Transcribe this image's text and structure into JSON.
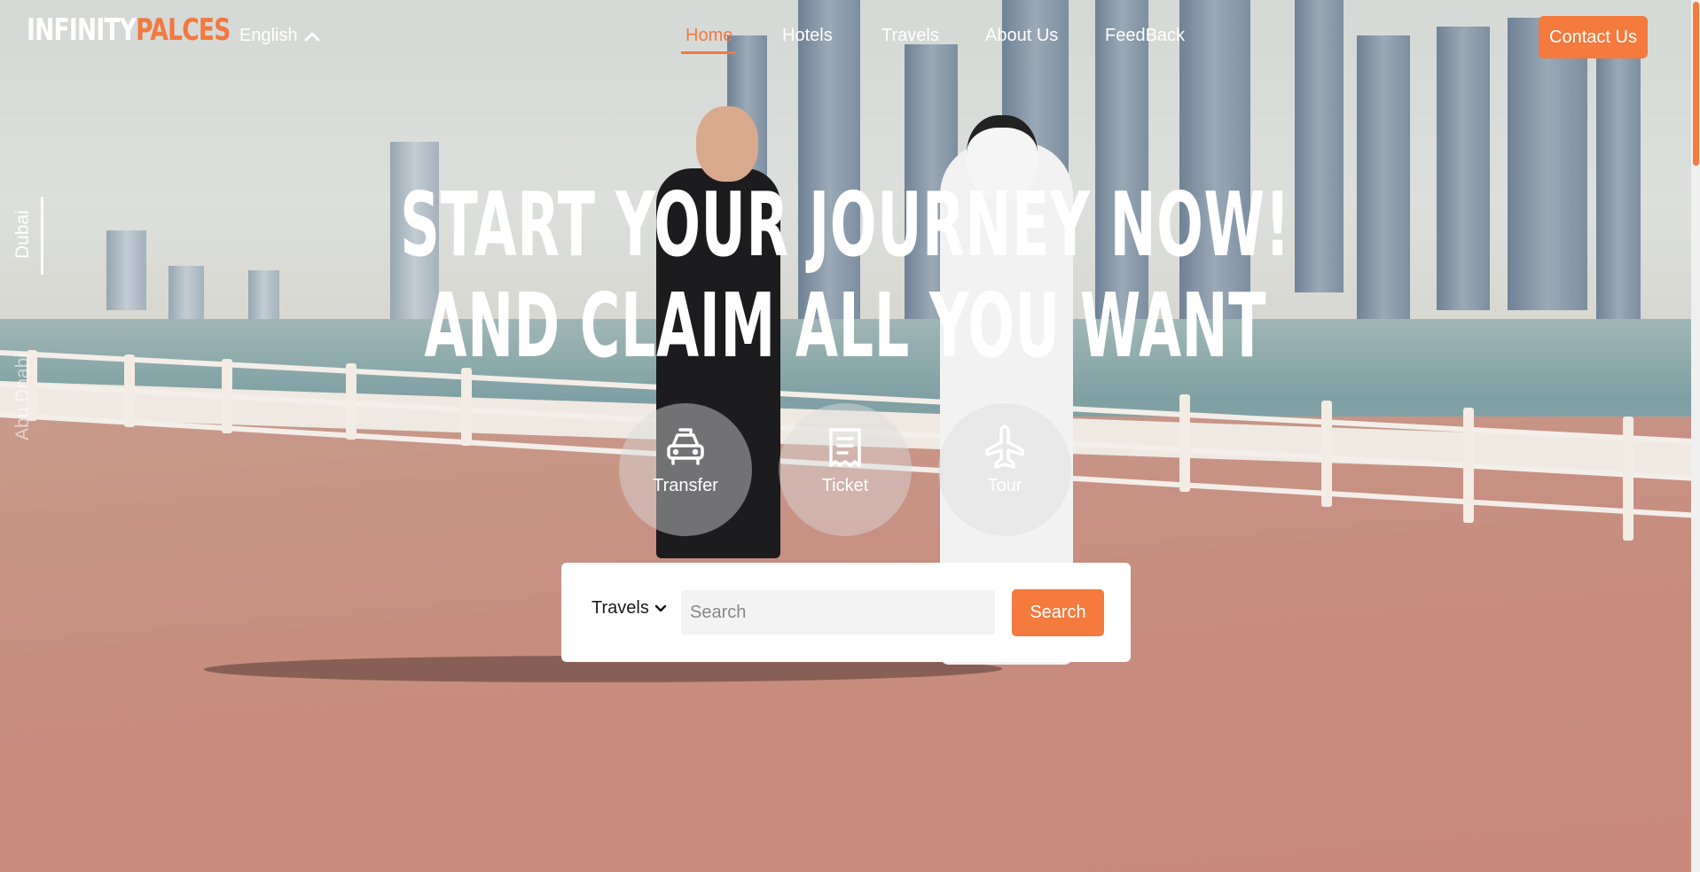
{
  "brand": {
    "logo_part1": "INFINITY",
    "logo_part2": "PALCES"
  },
  "header": {
    "language": "English",
    "nav": [
      "Home",
      "Hotels",
      "Travels",
      "About Us",
      "FeedBack"
    ],
    "active_nav": "Home",
    "contact_label": "Contact Us"
  },
  "side_locations": {
    "current": "Dubai",
    "next": "Abu Dhabi"
  },
  "hero": {
    "line1": "START YOUR JOURNEY NOW!",
    "line2": "AND CLAIM ALL YOU WANT"
  },
  "categories": [
    {
      "label": "Transfer",
      "icon": "car-icon"
    },
    {
      "label": "Ticket",
      "icon": "ticket-icon"
    },
    {
      "label": "Tour",
      "icon": "airplane-icon"
    }
  ],
  "search": {
    "type_selected": "Travels",
    "placeholder": "Search",
    "value": "",
    "button_label": "Search"
  },
  "colors": {
    "accent": "#f47a3e",
    "text_light": "#ffffff",
    "panel": "#ffffff"
  }
}
